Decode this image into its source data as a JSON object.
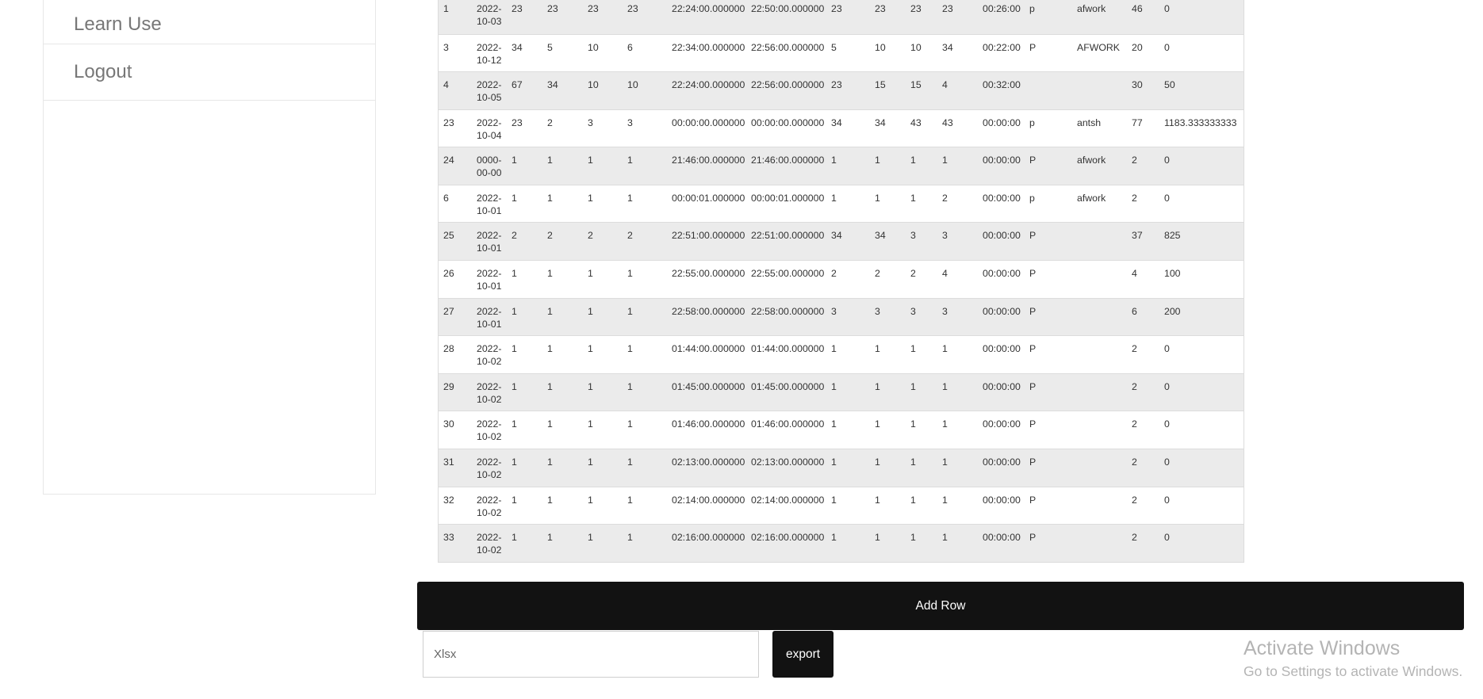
{
  "sidebar": {
    "items": [
      {
        "label": "Learn Use"
      },
      {
        "label": "Logout"
      }
    ]
  },
  "table": {
    "rows": [
      [
        "1",
        "2022-10-03",
        "23",
        "23",
        "23",
        "23",
        "22:24:00.000000",
        "22:50:00.000000",
        "23",
        "23",
        "23",
        "23",
        "00:26:00",
        "p",
        "afwork",
        "46",
        "0"
      ],
      [
        "3",
        "2022-10-12",
        "34",
        "5",
        "10",
        "6",
        "22:34:00.000000",
        "22:56:00.000000",
        "5",
        "10",
        "10",
        "34",
        "00:22:00",
        "P",
        "AFWORK",
        "20",
        "0"
      ],
      [
        "4",
        "2022-10-05",
        "67",
        "34",
        "10",
        "10",
        "22:24:00.000000",
        "22:56:00.000000",
        "23",
        "15",
        "15",
        "4",
        "00:32:00",
        "",
        "",
        "30",
        "50"
      ],
      [
        "23",
        "2022-10-04",
        "23",
        "2",
        "3",
        "3",
        "00:00:00.000000",
        "00:00:00.000000",
        "34",
        "34",
        "43",
        "43",
        "00:00:00",
        "p",
        "antsh",
        "77",
        "1183.333333333"
      ],
      [
        "24",
        "0000-00-00",
        "1",
        "1",
        "1",
        "1",
        "21:46:00.000000",
        "21:46:00.000000",
        "1",
        "1",
        "1",
        "1",
        "00:00:00",
        "P",
        "afwork",
        "2",
        "0"
      ],
      [
        "6",
        "2022-10-01",
        "1",
        "1",
        "1",
        "1",
        "00:00:01.000000",
        "00:00:01.000000",
        "1",
        "1",
        "1",
        "2",
        "00:00:00",
        "p",
        "afwork",
        "2",
        "0"
      ],
      [
        "25",
        "2022-10-01",
        "2",
        "2",
        "2",
        "2",
        "22:51:00.000000",
        "22:51:00.000000",
        "34",
        "34",
        "3",
        "3",
        "00:00:00",
        "P",
        "",
        "37",
        "825"
      ],
      [
        "26",
        "2022-10-01",
        "1",
        "1",
        "1",
        "1",
        "22:55:00.000000",
        "22:55:00.000000",
        "2",
        "2",
        "2",
        "4",
        "00:00:00",
        "P",
        "",
        "4",
        "100"
      ],
      [
        "27",
        "2022-10-01",
        "1",
        "1",
        "1",
        "1",
        "22:58:00.000000",
        "22:58:00.000000",
        "3",
        "3",
        "3",
        "3",
        "00:00:00",
        "P",
        "",
        "6",
        "200"
      ],
      [
        "28",
        "2022-10-02",
        "1",
        "1",
        "1",
        "1",
        "01:44:00.000000",
        "01:44:00.000000",
        "1",
        "1",
        "1",
        "1",
        "00:00:00",
        "P",
        "",
        "2",
        "0"
      ],
      [
        "29",
        "2022-10-02",
        "1",
        "1",
        "1",
        "1",
        "01:45:00.000000",
        "01:45:00.000000",
        "1",
        "1",
        "1",
        "1",
        "00:00:00",
        "P",
        "",
        "2",
        "0"
      ],
      [
        "30",
        "2022-10-02",
        "1",
        "1",
        "1",
        "1",
        "01:46:00.000000",
        "01:46:00.000000",
        "1",
        "1",
        "1",
        "1",
        "00:00:00",
        "P",
        "",
        "2",
        "0"
      ],
      [
        "31",
        "2022-10-02",
        "1",
        "1",
        "1",
        "1",
        "02:13:00.000000",
        "02:13:00.000000",
        "1",
        "1",
        "1",
        "1",
        "00:00:00",
        "P",
        "",
        "2",
        "0"
      ],
      [
        "32",
        "2022-10-02",
        "1",
        "1",
        "1",
        "1",
        "02:14:00.000000",
        "02:14:00.000000",
        "1",
        "1",
        "1",
        "1",
        "00:00:00",
        "P",
        "",
        "2",
        "0"
      ],
      [
        "33",
        "2022-10-02",
        "1",
        "1",
        "1",
        "1",
        "02:16:00.000000",
        "02:16:00.000000",
        "1",
        "1",
        "1",
        "1",
        "00:00:00",
        "P",
        "",
        "2",
        "0"
      ]
    ]
  },
  "actions": {
    "add_row_label": "Add Row",
    "export_label": "export",
    "xlsx_placeholder": "Xlsx",
    "xlsx_value": ""
  },
  "watermark": {
    "title": "Activate Windows",
    "subtitle": "Go to Settings to activate Windows."
  }
}
